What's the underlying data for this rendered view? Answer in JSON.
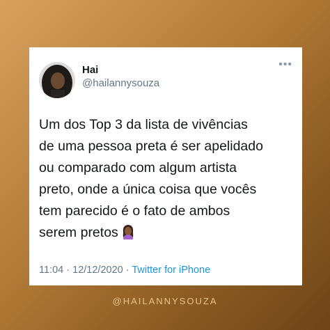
{
  "tweet": {
    "display_name": "Hai",
    "handle": "@hailannysouza",
    "more_icon": "more-icon",
    "text_lines": [
      "Um dos Top 3 da lista de vivências",
      "de uma pessoa preta é ser apelidado",
      "ou comparado com algum artista",
      "preto, onde a única coisa que vocês",
      "tem parecido é o fato de ambos",
      "serem pretos"
    ],
    "emoji": "woman-facepalming-emoji",
    "time": "11:04",
    "date": "12/12/2020",
    "separator": "·",
    "source": "Twitter for iPhone"
  },
  "footer": {
    "handle": "@HAILANNYSOUZA"
  },
  "colors": {
    "link": "#1b95e0",
    "muted": "#657786",
    "text": "#14171a",
    "background_from": "#d7a15e",
    "background_to": "#6e4418"
  }
}
